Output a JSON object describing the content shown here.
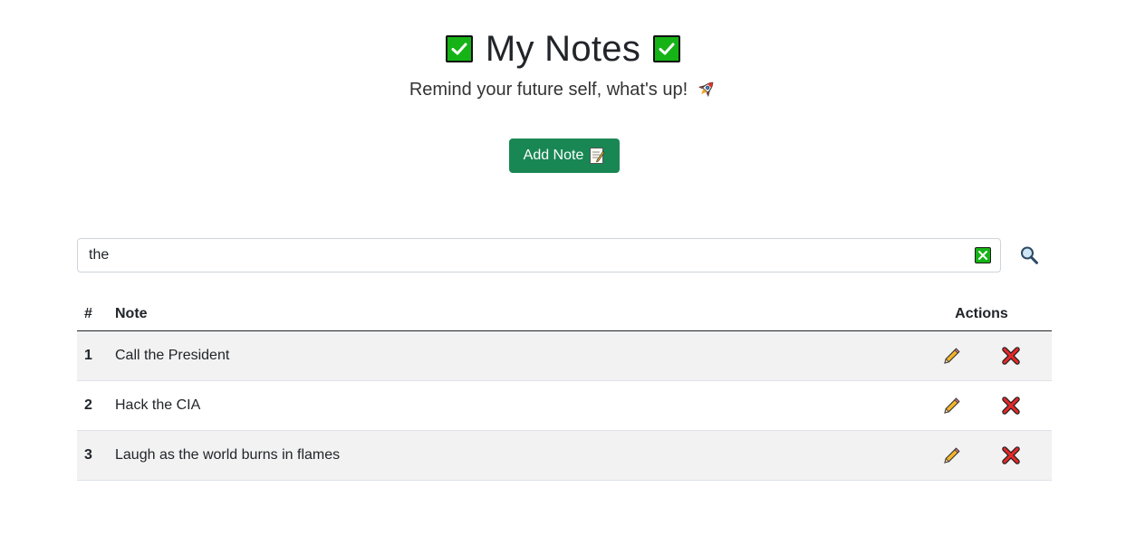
{
  "header": {
    "title": "My Notes",
    "subtitle": "Remind your future self, what's up!",
    "title_icon": "check-mark-button-icon",
    "subtitle_icon": "rocket-icon"
  },
  "actions": {
    "add_note_label": "Add Note",
    "add_note_icon": "memo-icon",
    "accent_color": "#198754"
  },
  "search": {
    "value": "the",
    "placeholder": "",
    "clear_icon": "cross-mark-button-icon",
    "search_icon": "magnifying-glass-icon"
  },
  "table": {
    "columns": {
      "num": "#",
      "note": "Note",
      "actions": "Actions"
    },
    "rows": [
      {
        "num": "1",
        "note": "Call the President"
      },
      {
        "num": "2",
        "note": "Hack the CIA"
      },
      {
        "num": "3",
        "note": "Laugh as the world burns in flames"
      }
    ],
    "row_action_icons": [
      "pencil-icon",
      "cross-mark-icon"
    ]
  }
}
